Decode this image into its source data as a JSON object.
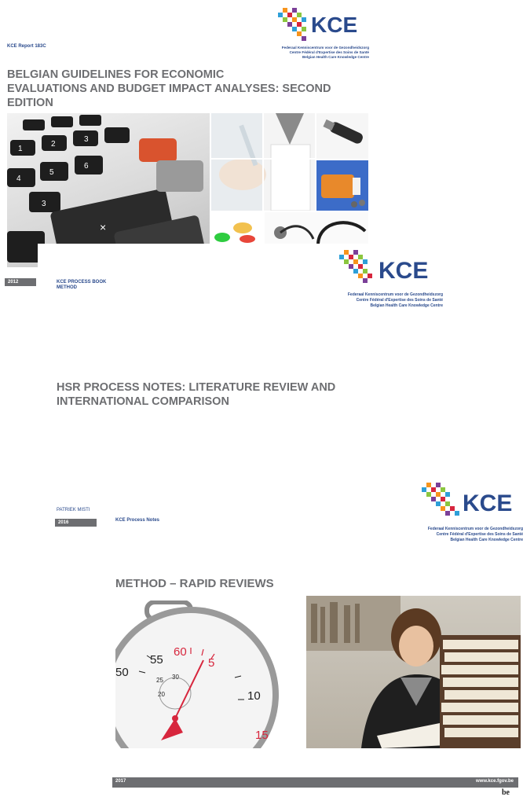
{
  "kce": {
    "wordmark": "KCE",
    "lines": [
      "Federaal Kenniscentrum voor de Gezondheidszorg",
      "Centre Fédéral d'Expertise des Soins de Santé",
      "Belgian Health Care Knowledge Centre"
    ],
    "colors": {
      "navy": "#2a4a8c",
      "green": "#8bc63f",
      "orange": "#f7941d",
      "blue": "#2e9fd8",
      "red": "#d7263d",
      "purple": "#7b3f98"
    }
  },
  "doc1": {
    "series": "KCE Report 183C",
    "title_lines": [
      "BELGIAN GUIDELINES FOR ECONOMIC",
      "EVALUATIONS AND BUDGET IMPACT ANALYSES: SECOND",
      "EDITION"
    ],
    "year": "2012",
    "images": [
      "calculator-photo",
      "doctor-syringe-photo",
      "otoscope-photo",
      "pills-bottle-photo",
      "capsules-photo",
      "stethoscope-photo"
    ]
  },
  "doc2": {
    "series_line1": "KCE PROCESS BOOK",
    "series_line2": "METHOD",
    "title_lines": [
      "HSR PROCESS NOTES: LITERATURE REVIEW AND",
      "INTERNATIONAL COMPARISON"
    ],
    "author": "PATRIEK MISTI",
    "year": "2016"
  },
  "doc3": {
    "series": "KCE Process Notes",
    "title": "METHOD – RAPID REVIEWS",
    "year": "2017",
    "url": "www.kce.fgov.be",
    "images": [
      "stopwatch-photo",
      "student-reading-photo"
    ],
    "stopwatch_numbers": [
      "55",
      "60",
      "5",
      "50",
      "10",
      "15",
      "25",
      "30",
      "20"
    ],
    "corner_logo": "be"
  }
}
